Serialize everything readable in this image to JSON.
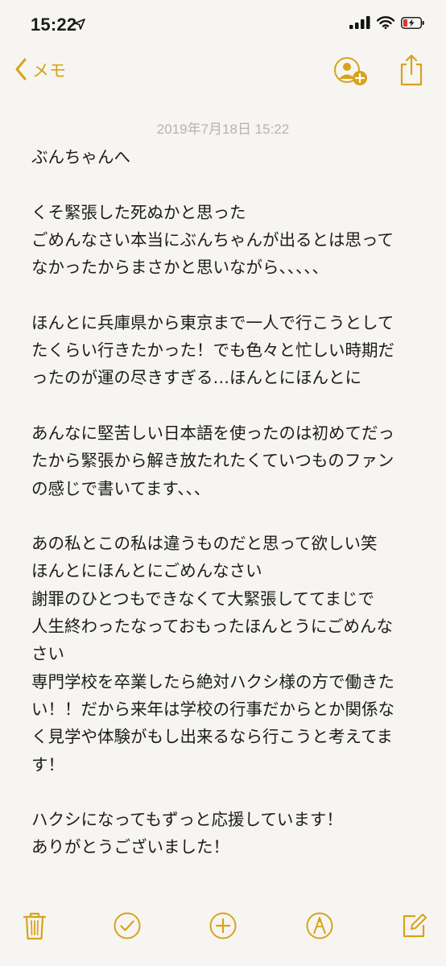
{
  "status_bar": {
    "time": "15:22",
    "icons": [
      "location-arrow-icon",
      "signal-icon",
      "wifi-icon",
      "battery-charging-icon"
    ]
  },
  "nav": {
    "back_label": "メモ",
    "icons": [
      "chevron-left-icon",
      "add-people-icon",
      "share-icon"
    ]
  },
  "note": {
    "date": "2019年7月18日 15:22",
    "lines": [
      "ぶんちゃんへ",
      "",
      "くそ緊張した死ぬかと思った",
      "ごめんなさい本当にぶんちゃんが出るとは思って",
      "なかったからまさかと思いながら、、、、、",
      "",
      "ほんとに兵庫県から東京まで一人で行こうとして",
      "たくらい行きたかった！でも色々と忙しい時期だ",
      "ったのが運の尽きすぎる…ほんとにほんとに",
      "",
      "あんなに堅苦しい日本語を使ったのは初めてだっ",
      "たから緊張から解き放たれたくていつものファン",
      "の感じで書いてます、、、",
      "",
      "あの私とこの私は違うものだと思って欲しい笑",
      "ほんとにほんとにごめんなさい",
      "謝罪のひとつもできなくて大緊張しててまじで",
      "人生終わったなっておもったほんとうにごめんな",
      "さい",
      "専門学校を卒業したら絶対ハクシ様の方で働きた",
      "い！！だから来年は学校の行事だからとか関係な",
      "く見学や体験がもし出来るなら行こうと考えてま",
      "す！",
      "",
      "ハクシになってもずっと応援しています！",
      "ありがとうございました！"
    ]
  },
  "toolbar": {
    "icons": [
      "trash-icon",
      "checklist-icon",
      "add-icon",
      "markup-icon",
      "compose-icon"
    ]
  },
  "colors": {
    "accent": "#d9a21c",
    "background": "#f6f5f1",
    "text": "#1c1c1c",
    "date": "#b6b4ae"
  }
}
